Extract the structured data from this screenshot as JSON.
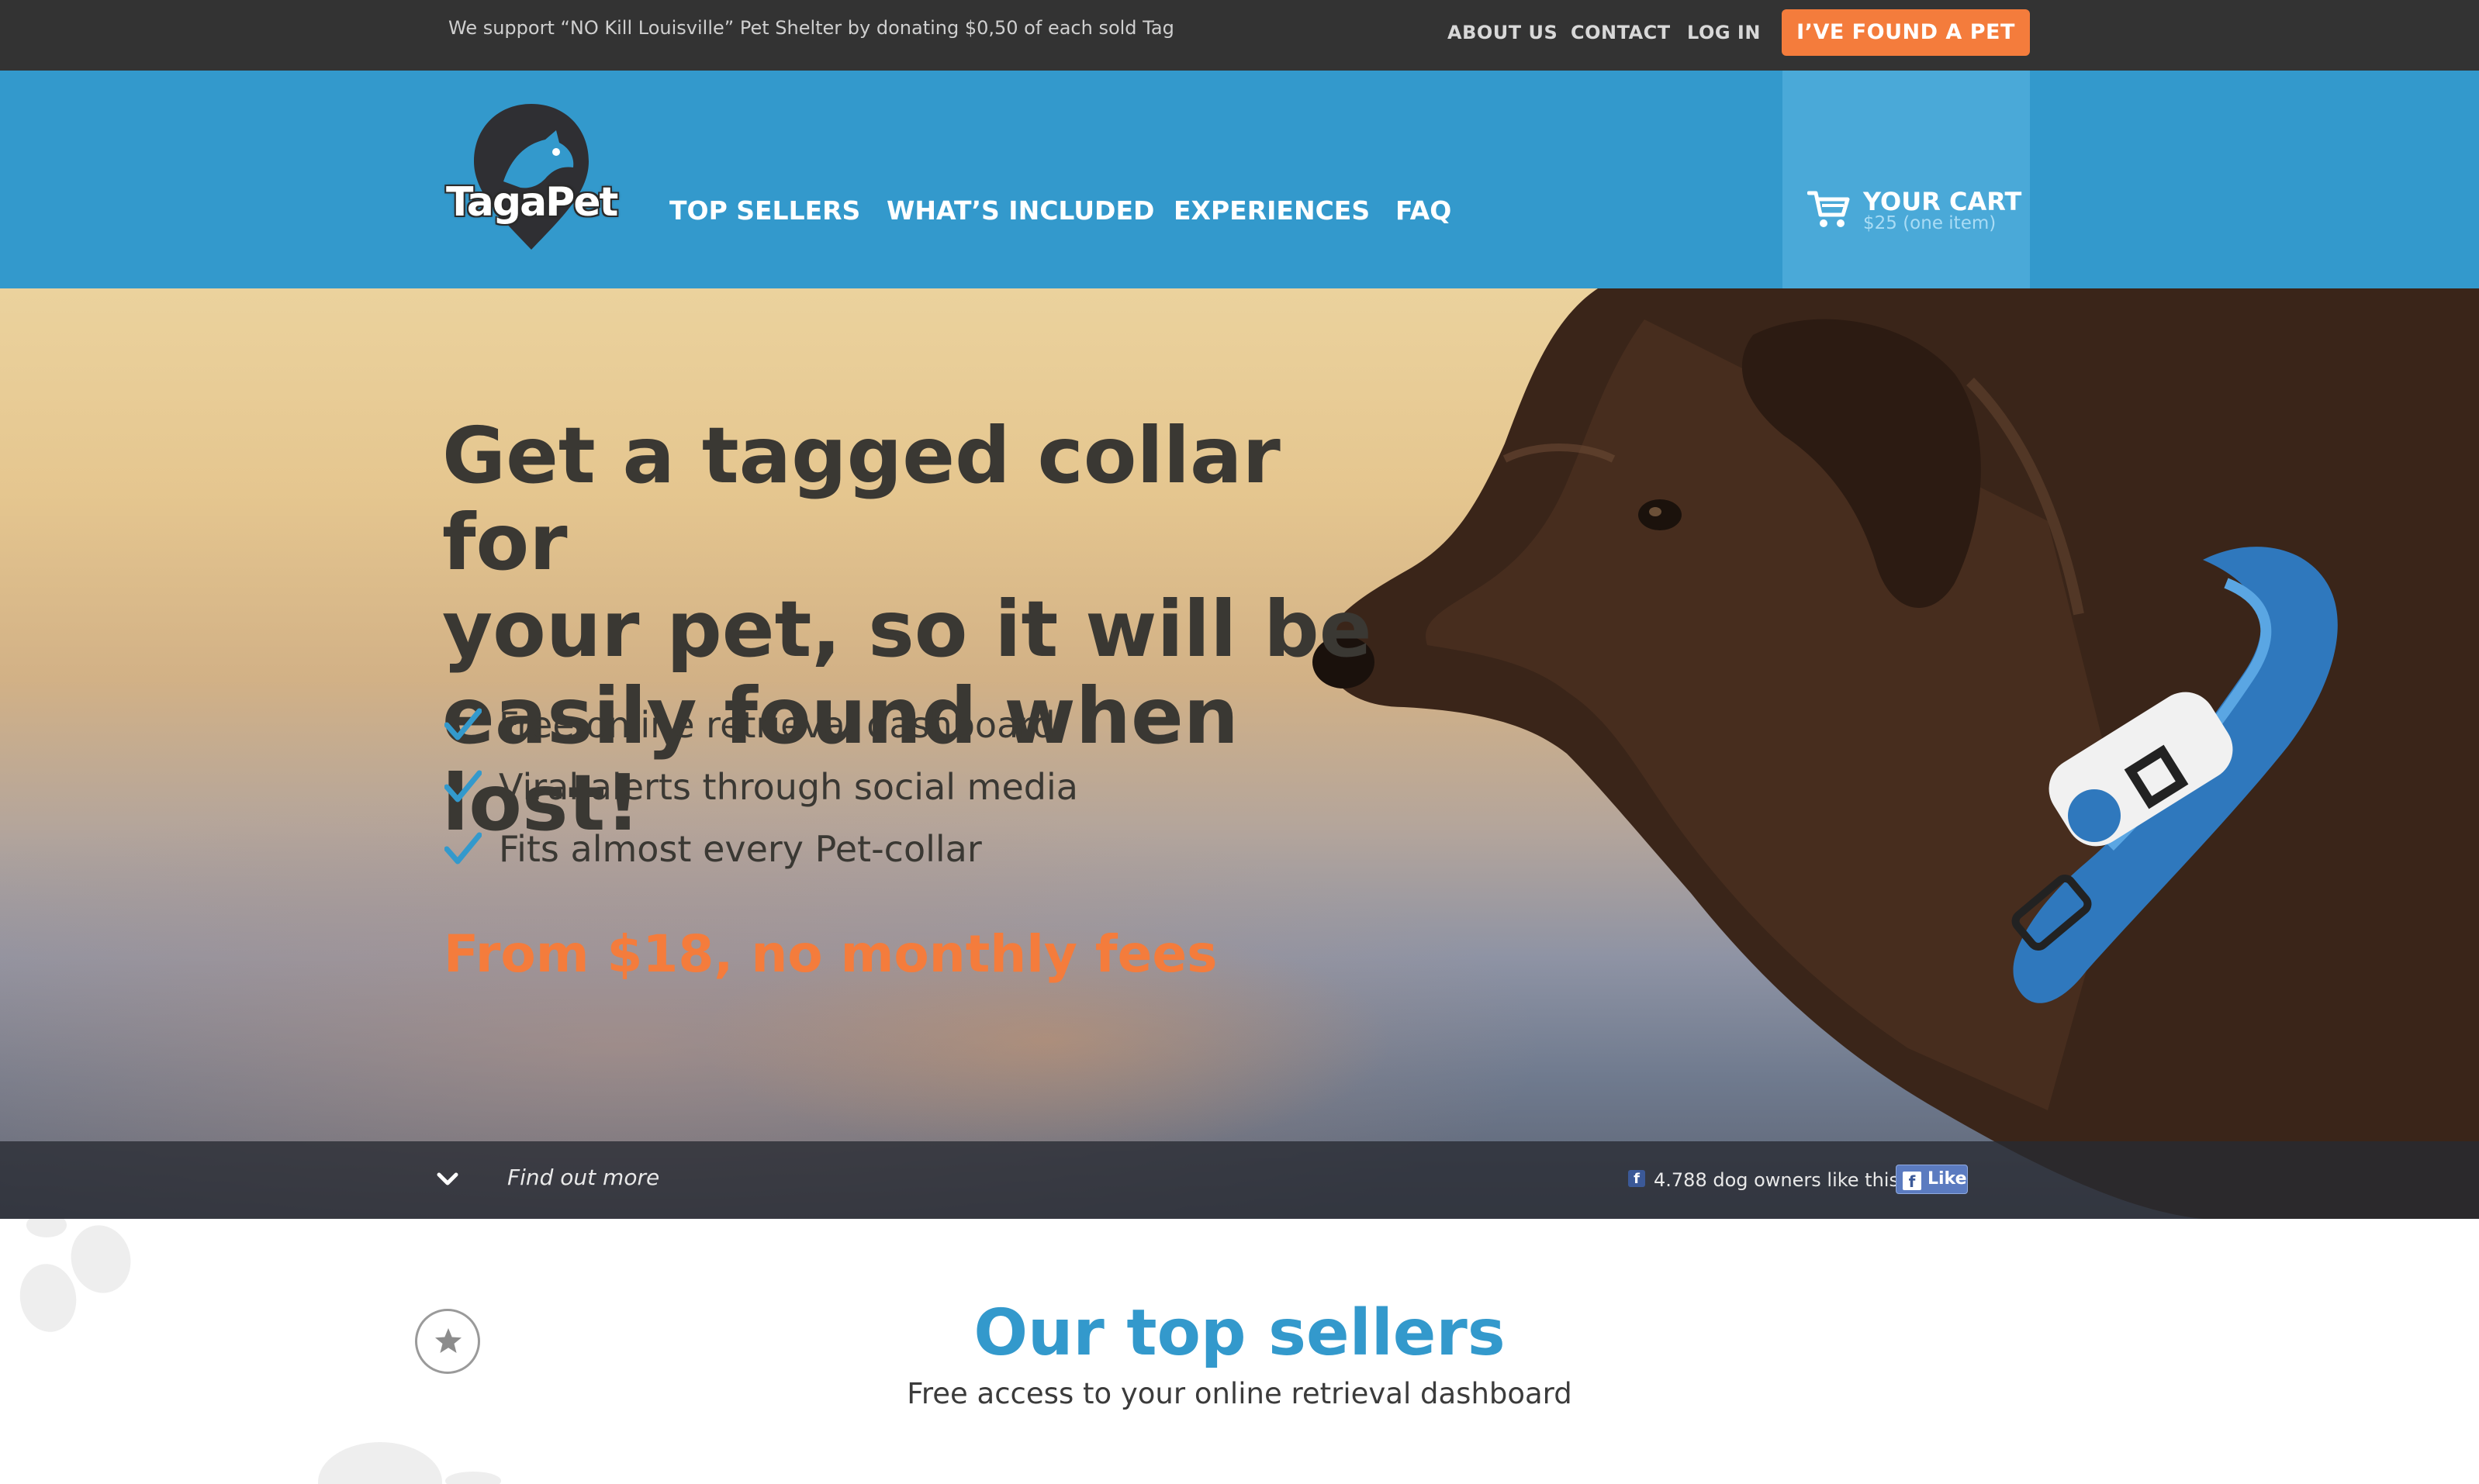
{
  "topbar": {
    "notice": "We support “NO Kill Louisville” Pet Shelter by donating $0,50 of each sold Tag",
    "links": [
      "ABOUT US",
      "CONTACT",
      "LOG IN"
    ],
    "found_button": "I’VE FOUND A PET"
  },
  "header": {
    "logo_text": "TagaPet",
    "nav": [
      "TOP SELLERS",
      "WHAT’S INCLUDED",
      "EXPERIENCES",
      "FAQ"
    ],
    "cart": {
      "title": "YOUR CART",
      "subtitle": "$25 (one item)"
    }
  },
  "hero": {
    "headline_lines": [
      "Get a tagged collar for",
      "your pet, so it will be",
      "easily found when lost!"
    ],
    "features": [
      "Free online retrieval dashboard",
      "Viral alerts through social media",
      "Fits almost every Pet-collar"
    ],
    "price": "From $18, no monthly fees",
    "find_more": "Find out more",
    "likes_text": "4.788 dog owners like this",
    "like_button": "Like"
  },
  "section": {
    "title": "Our top sellers",
    "subtitle": "Free access to your online retrieval dashboard"
  },
  "colors": {
    "accent_blue": "#3399cc",
    "accent_orange": "#f47c3c",
    "topbar": "#333333",
    "cart_bg": "#4aa9d8"
  },
  "icons": {
    "cart": "cart-icon",
    "check": "check-icon",
    "chevron": "chevron-down-icon",
    "facebook": "facebook-icon",
    "star": "star-icon"
  }
}
